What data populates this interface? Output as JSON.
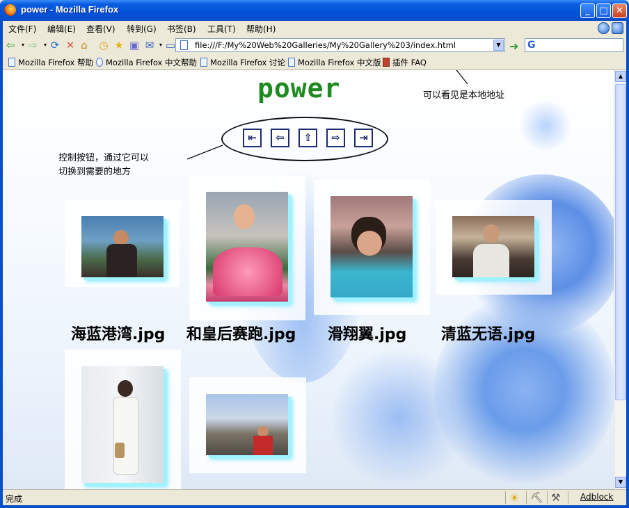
{
  "window": {
    "title": "power - Mozilla Firefox",
    "minimize": "_",
    "maximize": "□",
    "close": "✕"
  },
  "menu": [
    "文件(F)",
    "编辑(E)",
    "查看(V)",
    "转到(G)",
    "书签(B)",
    "工具(T)",
    "帮助(H)"
  ],
  "address": {
    "url": "file:///F:/My%20Web%20Galleries/My%20Gallery%203/index.html"
  },
  "search": {
    "engine_icon": "G"
  },
  "bookmarks": [
    "Mozilla Firefox 帮助",
    "Mozilla Firefox 中文帮助",
    "Mozilla Firefox 讨论",
    "Mozilla Firefox 中文版",
    "插件 FAQ"
  ],
  "page": {
    "title": "power",
    "annotation_url": "可以看见是本地地址",
    "annotation_nav_line1": "控制按钮，通过它可以",
    "annotation_nav_line2": "切换到需要的地方",
    "nav_buttons": [
      "first-icon",
      "previous-icon",
      "home-icon",
      "next-icon",
      "last-icon"
    ],
    "captions": [
      "海蓝港湾.jpg",
      "和皇后赛跑.jpg",
      "滑翔翼.jpg",
      "清蓝无语.jpg"
    ]
  },
  "status": {
    "text": "完成",
    "adblock": "Adblock"
  },
  "colors": {
    "title_bar": "#0a5ddf",
    "page_title": "#1f8a1f",
    "photo_glow": "#7de9ff"
  }
}
